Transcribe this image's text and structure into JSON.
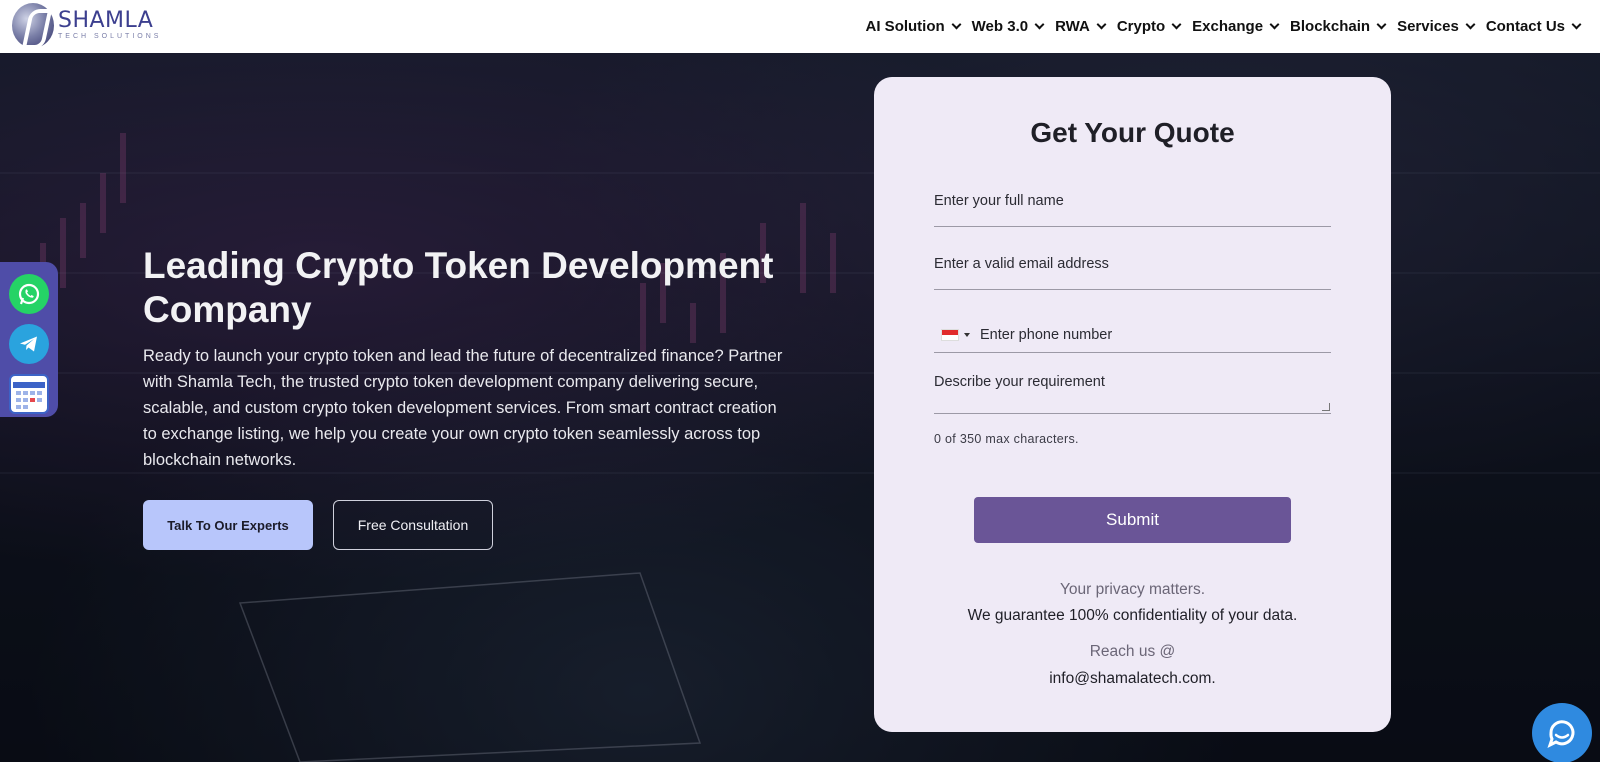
{
  "brand": {
    "name": "SHAMLA",
    "tagline": "TECH SOLUTIONS"
  },
  "nav": {
    "items": [
      {
        "label": "AI Solution"
      },
      {
        "label": "Web 3.0"
      },
      {
        "label": "RWA"
      },
      {
        "label": "Crypto"
      },
      {
        "label": "Exchange"
      },
      {
        "label": "Blockchain"
      },
      {
        "label": "Services"
      },
      {
        "label": "Contact Us"
      }
    ]
  },
  "hero": {
    "title": "Leading Crypto Token Development Company",
    "description": "Ready to launch your crypto token and lead the future of decentralized finance? Partner with Shamla Tech, the trusted crypto token development company delivering secure, scalable, and custom crypto token development services. From smart contract creation to exchange listing, we help you create your own crypto token seamlessly across top blockchain networks.",
    "primary_button": "Talk To Our Experts",
    "secondary_button": "Free Consultation"
  },
  "social": {
    "whatsapp_icon": "whatsapp-icon",
    "telegram_icon": "telegram-icon",
    "calendar_icon": "calendar-icon"
  },
  "form": {
    "title": "Get Your Quote",
    "name_placeholder": "Enter your full name",
    "email_placeholder": "Enter a valid email address",
    "phone_placeholder": "Enter phone number",
    "requirement_placeholder": "Describe your requirement",
    "char_count": "0 of 350 max characters.",
    "submit_label": "Submit",
    "privacy_line1": "Your privacy matters.",
    "privacy_line2": "We guarantee 100% confidentiality of your data.",
    "reach_label": "Reach us @",
    "email": "info@shamalatech.com."
  },
  "colors": {
    "accent": "#6a5597",
    "primary_button": "#b8c6fb",
    "form_bg": "#efeaf6",
    "chat": "#2f8ae0"
  }
}
